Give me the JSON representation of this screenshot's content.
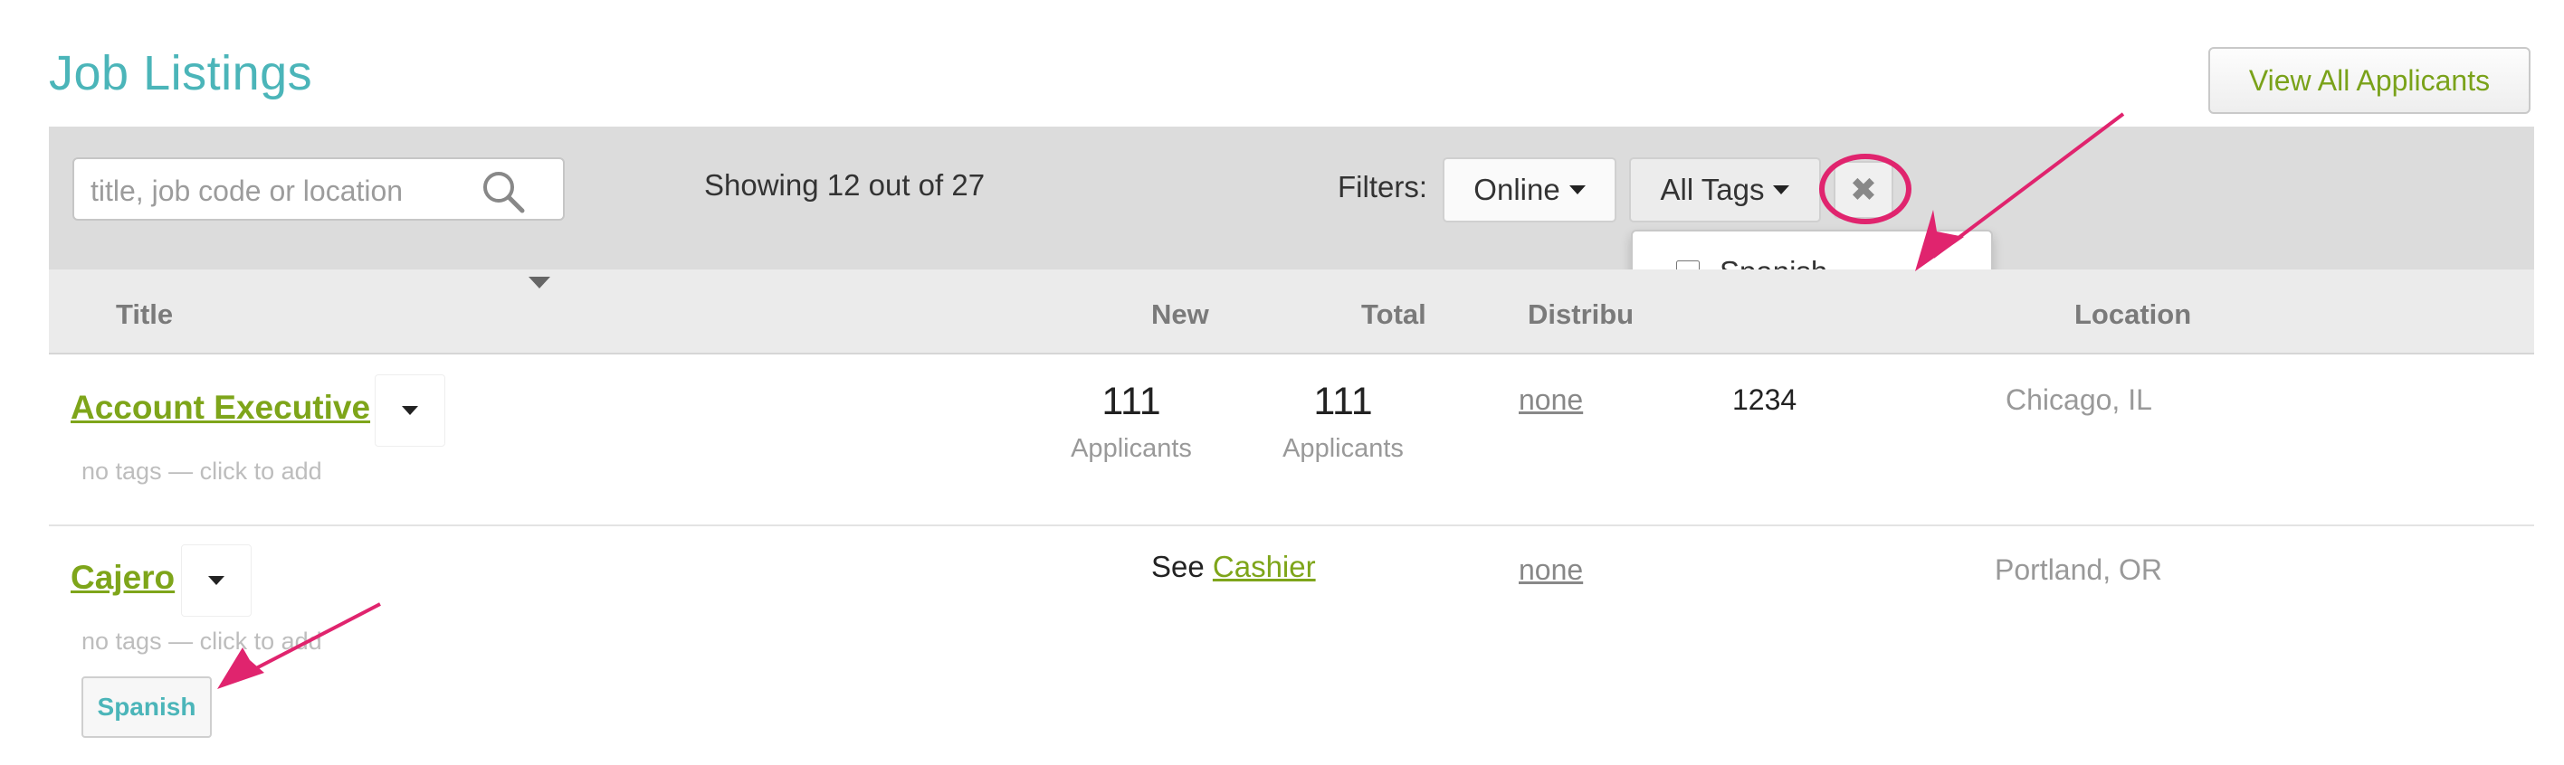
{
  "page": {
    "title": "Job Listings"
  },
  "header": {
    "view_all_label": "View All Applicants"
  },
  "filter_bar": {
    "search_placeholder": "title, job code or location",
    "showing_text": "Showing 12 out of 27",
    "filters_label": "Filters:",
    "status_filter": "Online",
    "tags_filter": "All Tags",
    "clear_icon": "times-icon",
    "tag_options": [
      {
        "label": "Spanish",
        "checked": false
      }
    ]
  },
  "columns": {
    "title": "Title",
    "new": "New",
    "total": "Total",
    "distribution": "Distribu",
    "location": "Location"
  },
  "rows": [
    {
      "title": "Account Executive",
      "tags_hint": "no tags — click to add",
      "new_count": "111",
      "new_label": "Applicants",
      "total_count": "111",
      "total_label": "Applicants",
      "distribution": "none",
      "job_code": "1234",
      "location": "Chicago, IL"
    },
    {
      "title": "Cajero",
      "tags_hint": "no tags — click to add",
      "see_prefix": "See",
      "see_link": "Cashier",
      "distribution": "none",
      "location": "Portland, OR",
      "tag": "Spanish"
    }
  ],
  "annotations": {
    "color": "#e0246e"
  },
  "colors": {
    "accent_teal": "#4bb5b9",
    "link_green": "#7ea51a",
    "filter_bar": "#dcdcdc"
  }
}
